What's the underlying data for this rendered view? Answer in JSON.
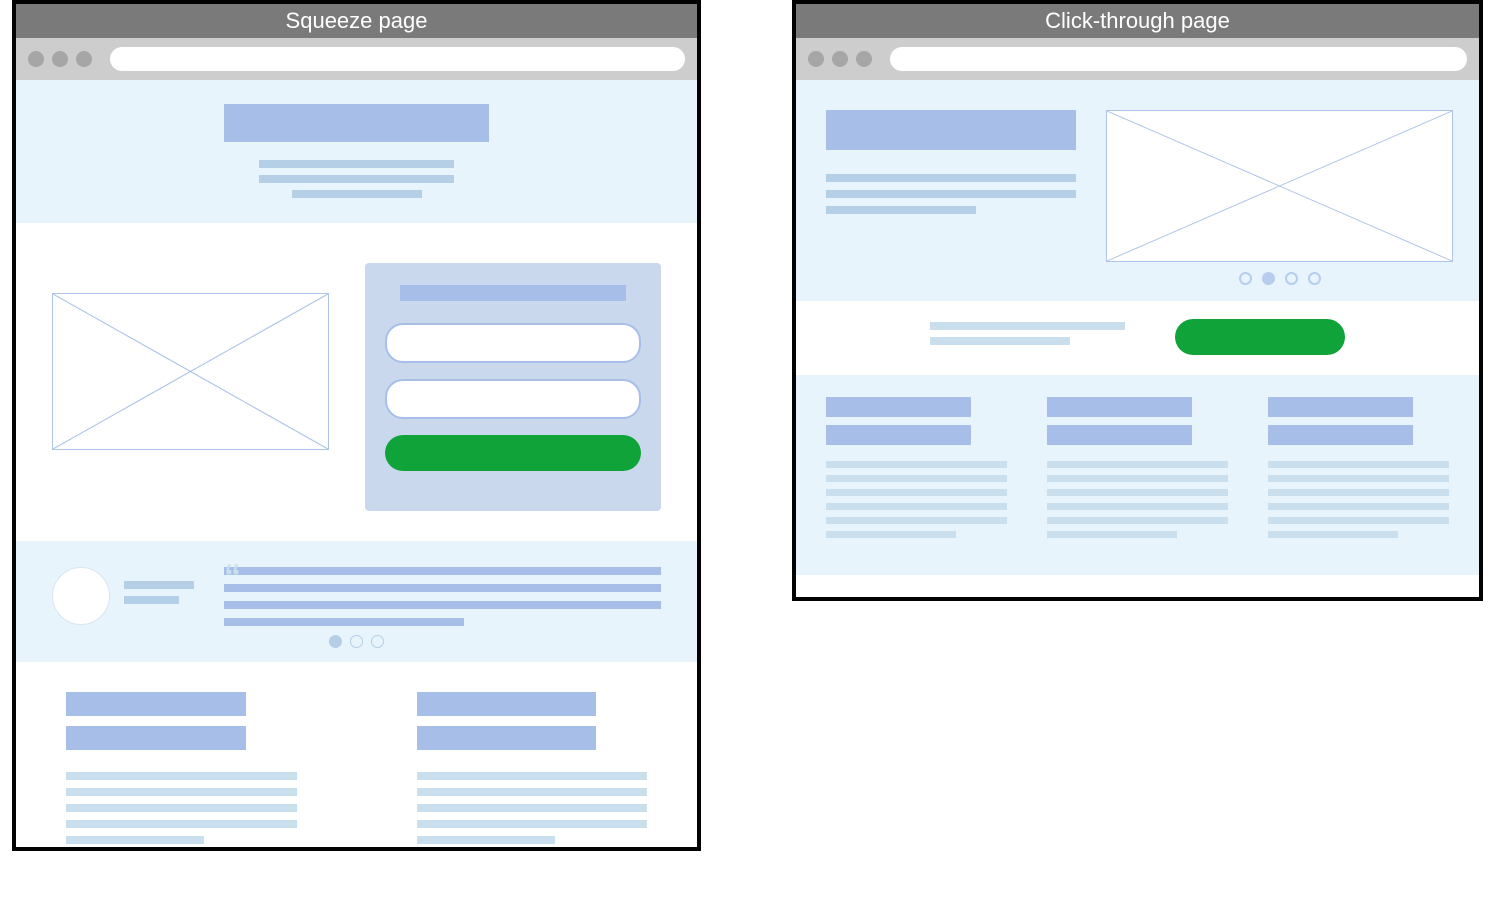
{
  "diagram": {
    "type": "wireframe-comparison",
    "left": {
      "title": "Squeeze page",
      "sections": [
        "hero",
        "image+form",
        "testimonial-carousel",
        "two-columns"
      ],
      "form": {
        "inputs": 2,
        "submit_color": "#0fa33a"
      },
      "testimonial_dots": {
        "count": 3,
        "active_index": 0
      }
    },
    "right": {
      "title": "Click-through page",
      "sections": [
        "hero-with-slider",
        "cta-row",
        "three-columns"
      ],
      "slider_dots": {
        "count": 4,
        "active_index": 1
      },
      "cta_button_color": "#0fa33a"
    }
  }
}
